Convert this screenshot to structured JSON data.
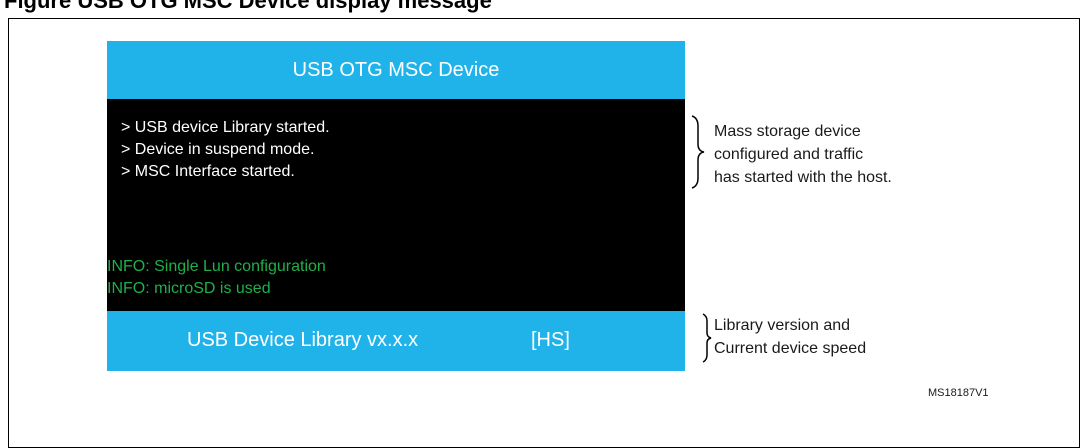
{
  "caption": "Figure    USB OTG MSC Device display message",
  "lcd": {
    "header_title": "USB OTG MSC Device",
    "log_lines": [
      "> USB device Library started.",
      "> Device in suspend mode.",
      "> MSC Interface started."
    ],
    "info_lines": [
      "INFO: Single Lun configuration",
      "INFO: microSD is used"
    ],
    "footer_library": "USB Device Library vx.x.x",
    "footer_speed": "[HS]"
  },
  "annotations": [
    {
      "lines": [
        "Mass storage device",
        "configured and traffic",
        "has started with the host."
      ]
    },
    {
      "lines": [
        "Library version and",
        "Current device speed"
      ]
    }
  ],
  "reference_code": "MS18187V1",
  "colors": {
    "lcd_bar": "#1fb3ea",
    "lcd_background": "#000000",
    "log_text": "#ffffff",
    "info_text": "#1fb04a"
  }
}
